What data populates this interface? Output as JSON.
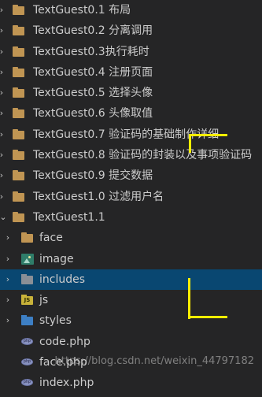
{
  "explorer": {
    "top_items": [
      {
        "label": "TextGuest0.1 布局",
        "icon": "folder-icon"
      },
      {
        "label": "TextGuest0.2 分离调用",
        "icon": "folder-icon"
      },
      {
        "label": "TextGuest0.3执行耗时",
        "icon": "folder-icon"
      },
      {
        "label": "TextGuest0.4 注册页面",
        "icon": "folder-icon"
      },
      {
        "label": "TextGuest0.5 选择头像",
        "icon": "folder-icon"
      },
      {
        "label": "TextGuest0.6 头像取值",
        "icon": "folder-icon"
      },
      {
        "label": "TextGuest0.7 验证码的基础制作详细",
        "icon": "folder-icon"
      },
      {
        "label": "TextGuest0.8 验证码的封装以及事项验证码",
        "icon": "folder-icon"
      },
      {
        "label": "TextGuest0.9 提交数据",
        "icon": "folder-icon"
      },
      {
        "label": "TextGuest1.0 过滤用户名",
        "icon": "folder-icon"
      },
      {
        "label": "TextGuest1.1",
        "icon": "folder-icon",
        "expanded": true
      }
    ],
    "children": [
      {
        "label": "face",
        "icon": "folder-icon"
      },
      {
        "label": "image",
        "icon": "image-folder-icon"
      },
      {
        "label": "includes",
        "icon": "includes-folder-icon",
        "selected": true
      },
      {
        "label": "js",
        "icon": "js-folder-icon"
      },
      {
        "label": "styles",
        "icon": "styles-folder-icon"
      }
    ],
    "files": [
      {
        "label": "code.php",
        "icon": "php-file-icon"
      },
      {
        "label": "face.php",
        "icon": "php-file-icon"
      },
      {
        "label": "index.php",
        "icon": "php-file-icon"
      }
    ]
  },
  "watermark": "https://blog.csdn.net/weixin_44797182",
  "colors": {
    "background": "#252526",
    "selection": "#094771",
    "annotation": "#ffee00"
  }
}
